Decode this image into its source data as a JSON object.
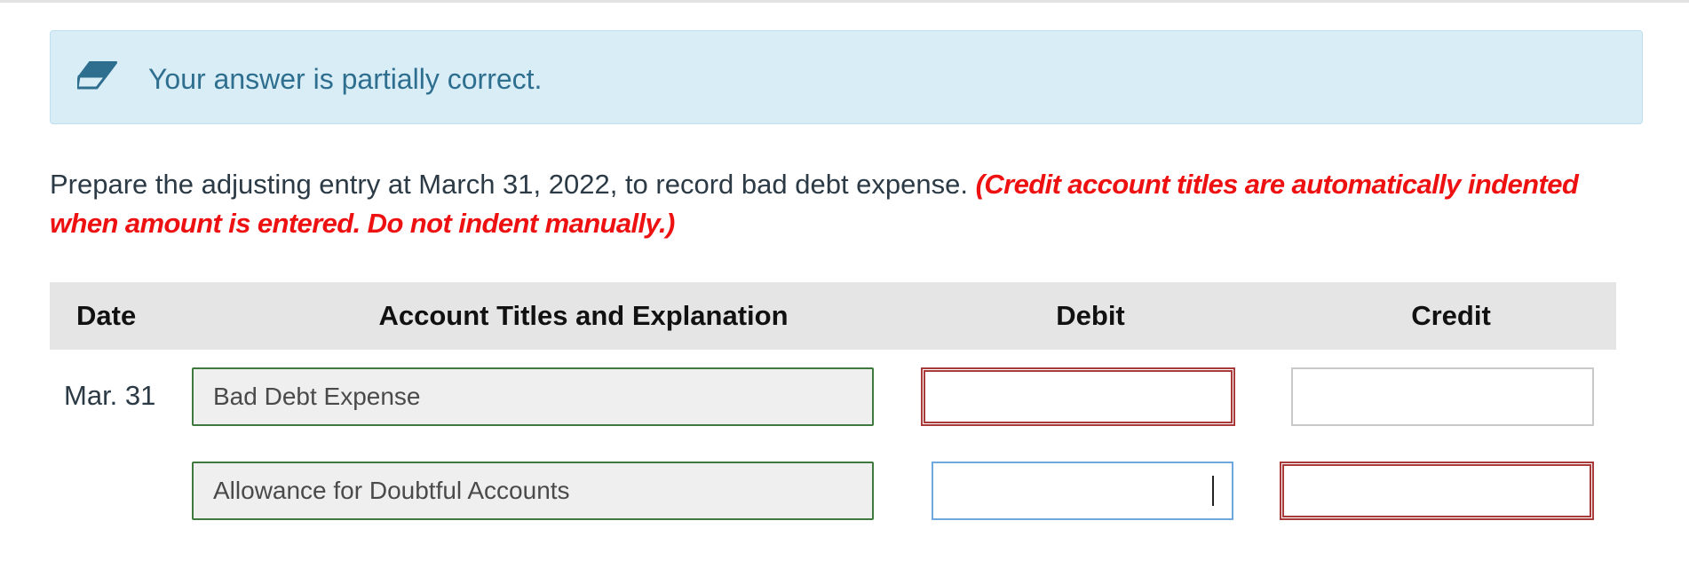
{
  "feedback": {
    "icon": "eraser-icon",
    "message": "Your answer is partially correct.",
    "background_color": "#d9edf6",
    "text_color": "#2e6f90"
  },
  "question": {
    "prompt": "Prepare the adjusting entry at March 31, 2022, to record bad debt expense. ",
    "note": "(Credit account titles are automatically indented when amount is entered. Do not indent manually.)",
    "note_color": "#ee1111"
  },
  "journal": {
    "columns": {
      "date": "Date",
      "account": "Account Titles and Explanation",
      "debit": "Debit",
      "credit": "Credit"
    },
    "rows": [
      {
        "date": "Mar. 31",
        "account": "Bad Debt Expense",
        "debit": "",
        "credit": "",
        "debit_state": "incorrect",
        "credit_state": "empty"
      },
      {
        "date": "",
        "account": "Allowance for Doubtful Accounts",
        "debit": "",
        "credit": "",
        "debit_state": "focused",
        "credit_state": "incorrect"
      }
    ],
    "correct_border_color": "#3e7a3e",
    "incorrect_border_color": "#a83a3a",
    "focus_border_color": "#6fa8dc"
  }
}
